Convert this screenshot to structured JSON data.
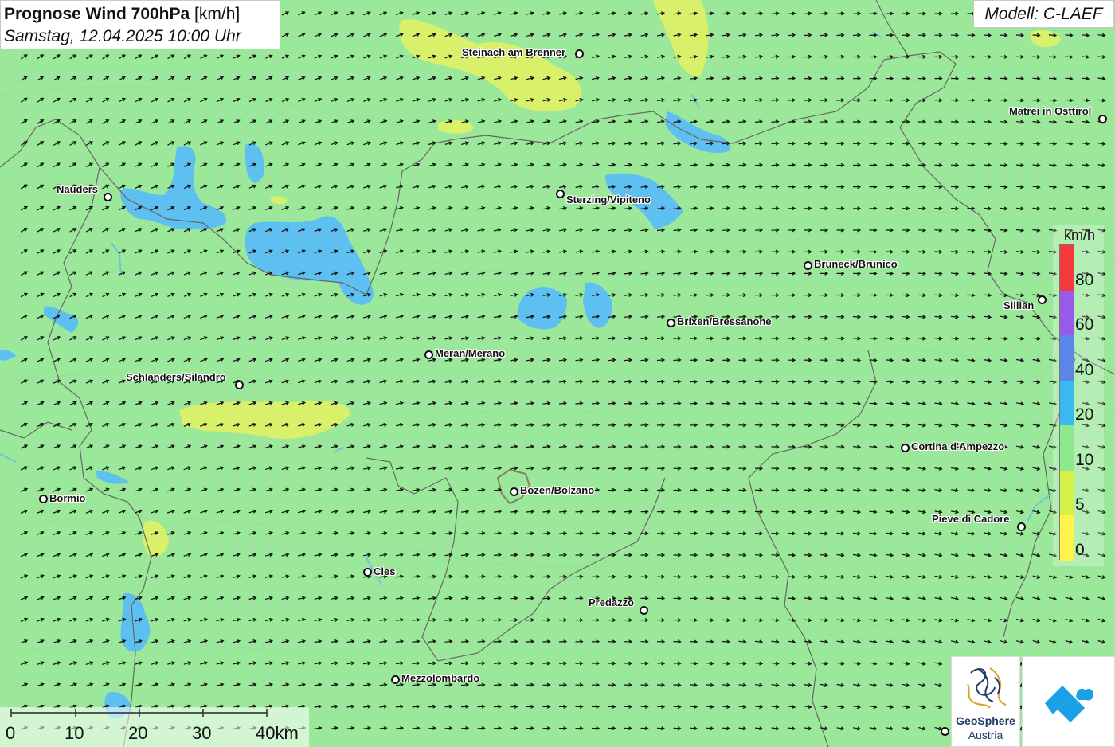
{
  "header": {
    "title_bold": "Prognose Wind 700hPa",
    "title_unit": "[km/h]",
    "datetime": "Samstag, 12.04.2025 10:00 Uhr"
  },
  "model_label": "Modell: C-LAEF",
  "cities": [
    {
      "name": "Steinach am Brenner"
    },
    {
      "name": "Matrei in Osttirol"
    },
    {
      "name": "Nauders"
    },
    {
      "name": "Sterzing/Vipiteno"
    },
    {
      "name": "Bruneck/Brunico"
    },
    {
      "name": "Sillian"
    },
    {
      "name": "Brixen/Bressanone"
    },
    {
      "name": "Meran/Merano"
    },
    {
      "name": "Schlanders/Silandro"
    },
    {
      "name": "Cortina d'Ampezzo"
    },
    {
      "name": "Bozen/Bolzano"
    },
    {
      "name": "Bormio"
    },
    {
      "name": "Pieve di Cadore"
    },
    {
      "name": "Cles"
    },
    {
      "name": "Predazzo"
    },
    {
      "name": "Mezzolombardo"
    }
  ],
  "legend": {
    "unit": "km/h",
    "levels": [
      {
        "label": "0",
        "color": "#fff24a"
      },
      {
        "label": "5",
        "color": "#d6f04a"
      },
      {
        "label": "10",
        "color": "#8ee88e"
      },
      {
        "label": "20",
        "color": "#3ab8f2"
      },
      {
        "label": "40",
        "color": "#5a86e8"
      },
      {
        "label": "60",
        "color": "#9a5ae8"
      },
      {
        "label": "80",
        "color": "#f23a3a"
      }
    ]
  },
  "scalebar": {
    "labels": [
      "0",
      "10",
      "20",
      "30",
      "40km"
    ]
  },
  "logos": {
    "geosphere_name": "GeoSphere",
    "geosphere_country": "Austria"
  },
  "colors": {
    "background": "#9be89b",
    "wind_5": "#d9f06a",
    "wind_20": "#5ec0f0"
  }
}
